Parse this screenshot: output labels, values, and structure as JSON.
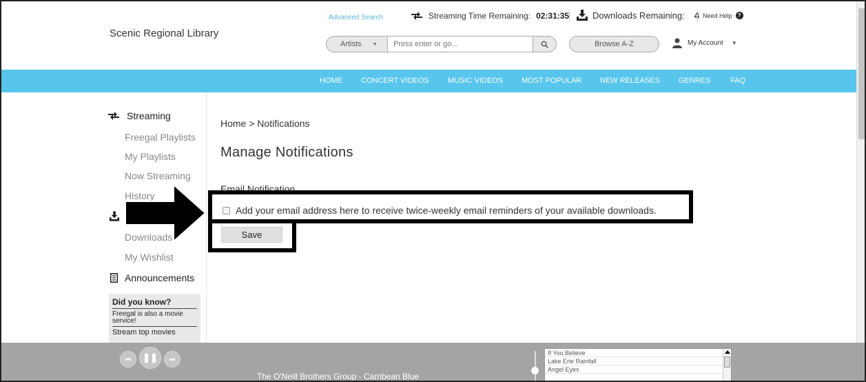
{
  "header": {
    "library_name": "Scenic Regional Library",
    "advanced_search": "Advanced Search",
    "streaming_label": "Streaming Time Remaining:",
    "streaming_time": "02:31:35",
    "downloads_label": "Downloads Remaining:",
    "downloads_count": "4",
    "need_help": "Need Help",
    "search_type": "Artists",
    "search_placeholder": "Press enter or go...",
    "browse_label": "Browse A-Z",
    "account_label": "My Account"
  },
  "nav": {
    "items": [
      "HOME",
      "CONCERT VIDEOS",
      "MUSIC VIDEOS",
      "MOST POPULAR",
      "NEW RELEASES",
      "GENRES",
      "FAQ"
    ]
  },
  "sidebar": {
    "streaming_heading": "Streaming",
    "streaming_links": [
      "Freegal Playlists",
      "My Playlists",
      "Now Streaming",
      "History"
    ],
    "download_links": [
      "Downloads",
      "My Wishlist"
    ],
    "announcements": "Announcements",
    "did_you_know": {
      "title": "Did you know?",
      "text": "Freegal is also a movie service!",
      "text2": "Stream top movies"
    }
  },
  "main": {
    "breadcrumb": "Home > Notifications",
    "title": "Manage Notifications",
    "section_label": "Email Notification",
    "checkbox_label": "Add your email address here to receive twice-weekly email reminders of your available downloads.",
    "checkbox_checked": false,
    "save_label": "Save"
  },
  "player": {
    "now_playing": "The O'Neill Brothers Group - Carribean Blue",
    "playlist": [
      "If You Believe",
      "Lake Erie Rainfall",
      "Angel Eyes"
    ]
  },
  "colors": {
    "nav_bar": "#57c5ec",
    "player_bar": "#a4a4a4",
    "link_blue": "#5ab4d8",
    "annotation": "#000000"
  }
}
